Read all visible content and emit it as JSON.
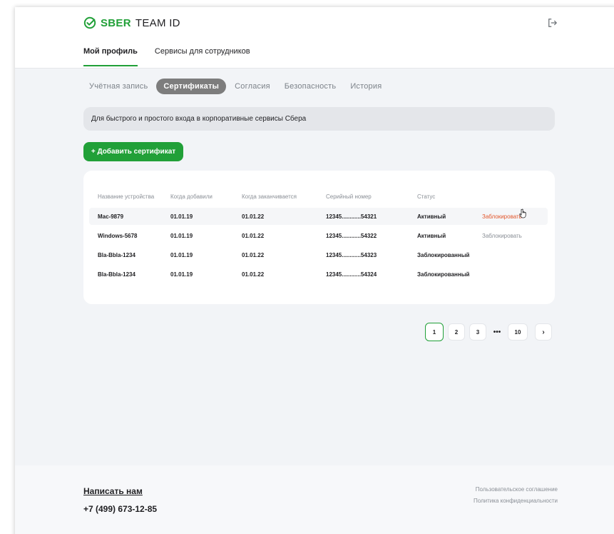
{
  "header": {
    "logo_primary": "SBER",
    "logo_secondary": "TEAM ID",
    "nav": [
      {
        "label": "Мой профиль",
        "active": true
      },
      {
        "label": "Сервисы для сотрудников",
        "active": false
      }
    ]
  },
  "tabs": [
    {
      "label": "Учётная запись",
      "active": false
    },
    {
      "label": "Сертификаты",
      "active": true
    },
    {
      "label": "Согласия",
      "active": false
    },
    {
      "label": "Безопасность",
      "active": false
    },
    {
      "label": "История",
      "active": false
    }
  ],
  "banner_text": "Для быстрого и простого входа в корпоративные сервисы Сбера",
  "add_button_label": "+ Добавить сертификат",
  "table": {
    "columns": [
      "Название устройства",
      "Когда добавили",
      "Когда заканчивается",
      "Серийный номер",
      "Статус"
    ],
    "rows": [
      {
        "device": "Mac-9879",
        "added": "01.01.19",
        "expires": "01.01.22",
        "serial": "12345............54321",
        "status": "Активный",
        "action": "Заблокировать"
      },
      {
        "device": "Windows-5678",
        "added": "01.01.19",
        "expires": "01.01.22",
        "serial": "12345............54322",
        "status": "Активный",
        "action": "Заблокировать"
      },
      {
        "device": "Bla-Bbla-1234",
        "added": "01.01.19",
        "expires": "01.01.22",
        "serial": "12345............54323",
        "status": "Заблокированный",
        "action": ""
      },
      {
        "device": "Bla-Bbla-1234",
        "added": "01.01.19",
        "expires": "01.01.22",
        "serial": "12345............54324",
        "status": "Заблокированный",
        "action": ""
      }
    ]
  },
  "pagination": {
    "pages": [
      "1",
      "2",
      "3"
    ],
    "ellipsis": "•••",
    "last": "10",
    "next": "›",
    "current": "1"
  },
  "footer": {
    "write_us": "Написать нам",
    "phone": "+7 (499) 673-12-85",
    "links": [
      "Пользовательское соглашение",
      "Политика конфиденциальности"
    ]
  },
  "colors": {
    "brand_green": "#21a038",
    "action_red": "#e2572c",
    "tab_active_bg": "#7d7d7d"
  }
}
